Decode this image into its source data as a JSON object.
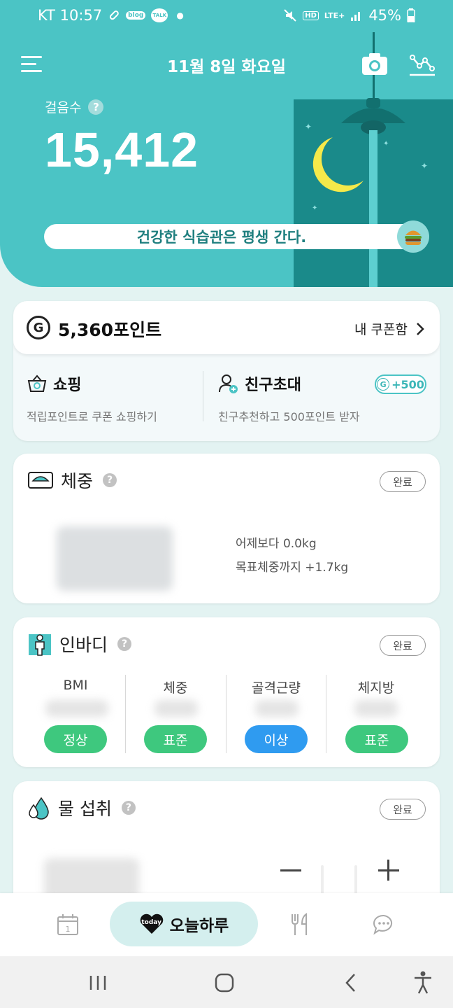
{
  "status_bar": {
    "carrier_time": "KT 10:57",
    "battery": "45%",
    "icons": [
      "pill-icon",
      "blog-icon",
      "talk-icon",
      "dot-icon",
      "mute-icon",
      "hd-icon",
      "lte-icon",
      "signal-icon",
      "battery-icon"
    ],
    "blog_text": "blog",
    "talk_text": "TALK",
    "hd_text": "HD",
    "lte_text": "LTE+"
  },
  "header": {
    "date": "11월 8일 화요일",
    "steps_label": "걸음수",
    "steps_count": "15,412",
    "slogan": "건강한 식습관은 평생 간다.",
    "help_mark": "?",
    "colors": {
      "teal": "#4bc4c5",
      "night": "#1a8a8a",
      "moon": "#f5e94a"
    }
  },
  "points": {
    "coin_letter": "G",
    "amount": "5,360포인트",
    "coupon_link": "내 쿠폰함",
    "shopping": {
      "title": "쇼핑",
      "subtitle": "적립포인트로 쿠폰 쇼핑하기"
    },
    "invite": {
      "title": "친구초대",
      "subtitle": "친구추천하고 500포인트 받자",
      "bonus": "+500",
      "bonus_coin": "G"
    }
  },
  "weight": {
    "title": "체중",
    "done_label": "완료",
    "diff_yesterday": "어제보다 0.0kg",
    "diff_goal": "목표체중까지 +1.7kg"
  },
  "body_comp": {
    "title": "인바디",
    "done_label": "완료",
    "columns": [
      {
        "label": "BMI",
        "status": "정상",
        "status_color": "#3ec87e"
      },
      {
        "label": "체중",
        "status": "표준",
        "status_color": "#3ec87e"
      },
      {
        "label": "골격근량",
        "status": "이상",
        "status_color": "#2f9bf0"
      },
      {
        "label": "체지방",
        "status": "표준",
        "status_color": "#3ec87e"
      }
    ]
  },
  "water": {
    "title": "물 섭취",
    "done_label": "완료"
  },
  "tabbar": {
    "calendar_day": "1",
    "today_badge": "today",
    "today_label": "오늘하루"
  }
}
